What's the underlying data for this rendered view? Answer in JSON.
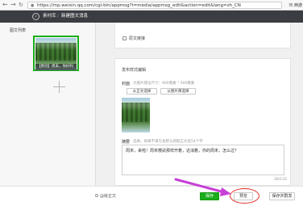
{
  "browser": {
    "url": "https://mp.weixin.qq.com/cgi-bin/appmsg?t=media/appmsg_edit&action=edit&lang=zh_CN",
    "right_label": "西游"
  },
  "header": {
    "home_label": "素材库",
    "separator": "/",
    "current_label": "新建图文消息"
  },
  "sidebar": {
    "title": "图文列表",
    "card_caption": "【原创】周末，你好吗"
  },
  "editor": {
    "source_link_label": "原文链接",
    "settings_title": "发布样式编辑",
    "cover_label": "封面",
    "cover_hint": "大图片建议尺寸：900像素 * 500像素",
    "from_body_button": "从正文选择",
    "from_library_button": "从图片库选择",
    "summary_label": "摘要",
    "summary_hint": "选填，如果不填写会默认抓取正文前54个字",
    "summary_text": "周末，来啦！周末櫻武那样开着，这消着，你的周末，怎么过？",
    "summary_count": "28/120"
  },
  "actions": {
    "public_label": "@就正文",
    "save_label": "保存",
    "preview_label": "预览",
    "send_label": "保存并群发"
  },
  "colors": {
    "accent": "#1aad19",
    "annotation_arrow": "#c73fd6",
    "annotation_circle": "#e4312b"
  }
}
